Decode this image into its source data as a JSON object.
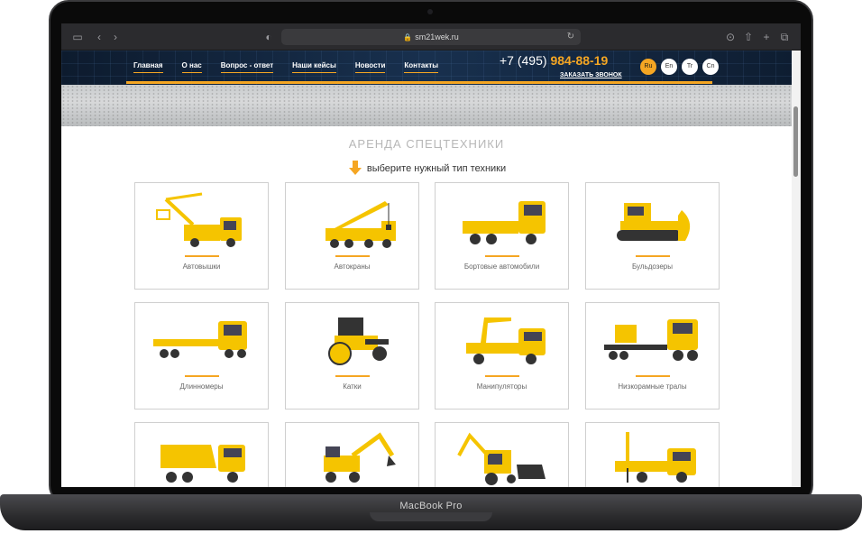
{
  "device": {
    "brand_label": "MacBook Pro"
  },
  "browser": {
    "url": "sm21wek.ru",
    "icons": [
      "sidebar-icon",
      "back-icon",
      "forward-icon",
      "shield-icon",
      "lock-icon",
      "reload-icon",
      "download-icon",
      "share-icon",
      "new-tab-icon",
      "tabs-icon"
    ]
  },
  "header": {
    "nav": [
      "Главная",
      "О нас",
      "Вопрос - ответ",
      "Наши кейсы",
      "Новости",
      "Контакты"
    ],
    "phone_prefix": "+7 (495)",
    "phone_main": "984-88-19",
    "callback_label": "ЗАКАЗАТЬ ЗВОНОК",
    "languages": [
      "Ru",
      "En",
      "Tr",
      "Cn"
    ],
    "active_language": "Ru"
  },
  "main": {
    "title": "АРЕНДА СПЕЦТЕХНИКИ",
    "subtitle": "выберите нужный тип техники",
    "categories": [
      {
        "label": "Автовышки",
        "icon": "aerial-platform-truck"
      },
      {
        "label": "Автокраны",
        "icon": "truck-crane"
      },
      {
        "label": "Бортовые автомобили",
        "icon": "flatbed-truck"
      },
      {
        "label": "Бульдозеры",
        "icon": "bulldozer"
      },
      {
        "label": "Длинномеры",
        "icon": "long-trailer-truck"
      },
      {
        "label": "Катки",
        "icon": "road-roller"
      },
      {
        "label": "Манипуляторы",
        "icon": "crane-manipulator-truck"
      },
      {
        "label": "Низкорамные тралы",
        "icon": "lowboy-trailer"
      },
      {
        "label": "",
        "icon": "dump-truck"
      },
      {
        "label": "",
        "icon": "wheeled-excavator"
      },
      {
        "label": "",
        "icon": "backhoe-loader"
      },
      {
        "label": "",
        "icon": "drilling-truck"
      }
    ]
  },
  "colors": {
    "accent": "#f5a623",
    "header_bg": "#0d1b2e",
    "title_gray": "#b7b7b7"
  }
}
